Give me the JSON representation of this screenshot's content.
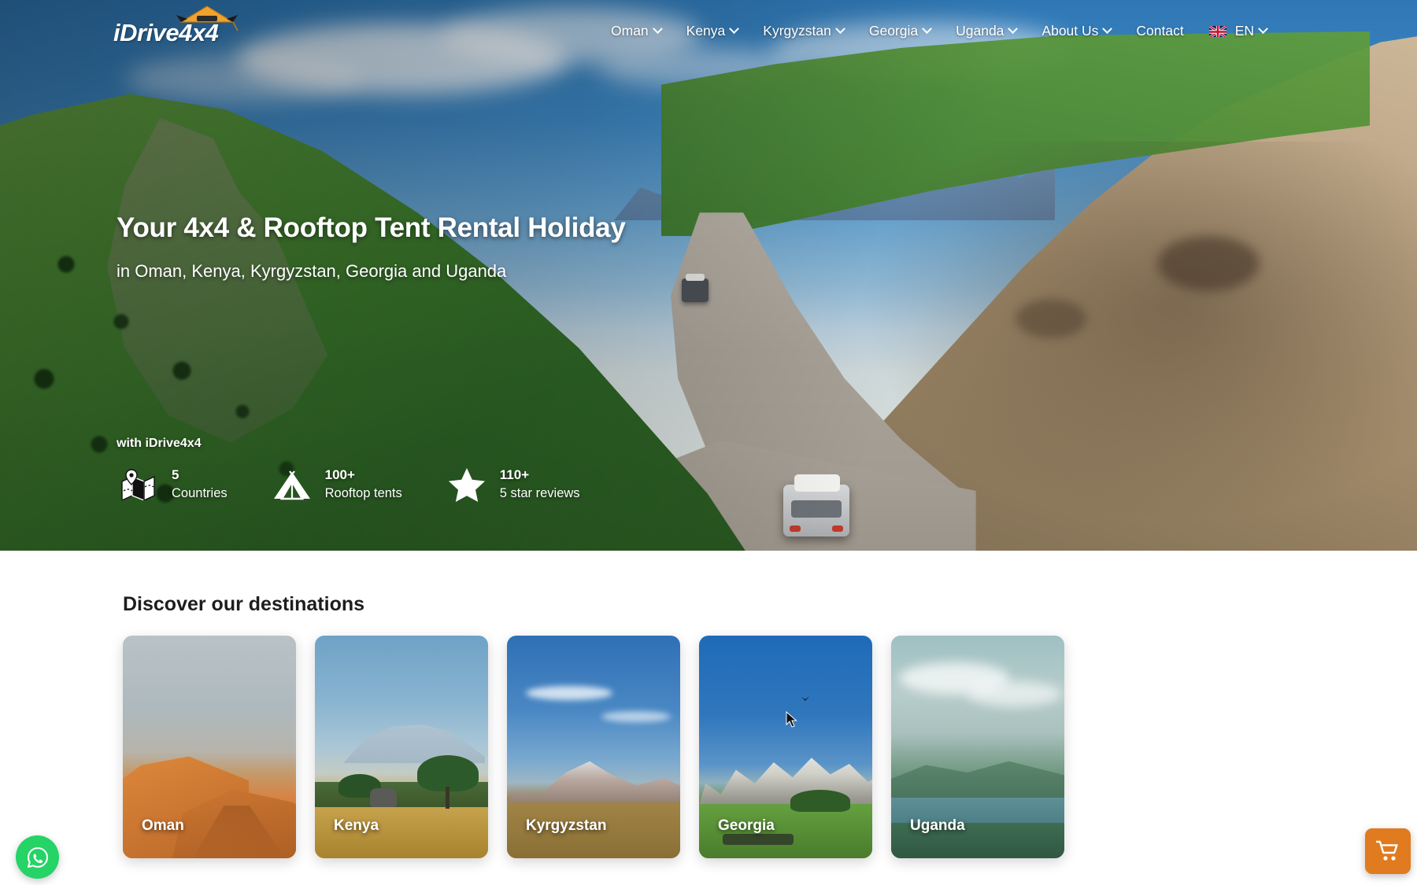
{
  "brand": {
    "logo_text": "iDrive4x4",
    "logo_icon": "rooftop-tent-icon",
    "accent_color": "#e8941f"
  },
  "nav": {
    "items": [
      {
        "label": "Oman",
        "has_dropdown": true
      },
      {
        "label": "Kenya",
        "has_dropdown": true
      },
      {
        "label": "Kyrgyzstan",
        "has_dropdown": true
      },
      {
        "label": "Georgia",
        "has_dropdown": true
      },
      {
        "label": "Uganda",
        "has_dropdown": true
      },
      {
        "label": "About Us",
        "has_dropdown": true
      },
      {
        "label": "Contact",
        "has_dropdown": false
      }
    ],
    "language": {
      "code": "EN",
      "flag_icon": "uk-flag-icon",
      "has_dropdown": true
    }
  },
  "hero": {
    "title": "Your 4x4 & Rooftop Tent Rental Holiday",
    "subtitle": "in Oman, Kenya, Kyrgyzstan, Georgia and Uganda",
    "stats_heading": "with iDrive4x4",
    "stats": [
      {
        "icon": "map-pin-icon",
        "value": "5",
        "label": "Countries"
      },
      {
        "icon": "tent-icon",
        "value": "100+",
        "label": "Rooftop tents"
      },
      {
        "icon": "star-icon",
        "value": "110+",
        "label": "5 star reviews"
      }
    ]
  },
  "destinations": {
    "title": "Discover our destinations",
    "cards": [
      {
        "label": "Oman",
        "theme": "oman"
      },
      {
        "label": "Kenya",
        "theme": "kenya"
      },
      {
        "label": "Kyrgyzstan",
        "theme": "kyr"
      },
      {
        "label": "Georgia",
        "theme": "geo"
      },
      {
        "label": "Uganda",
        "theme": "uga"
      }
    ]
  },
  "floating": {
    "whatsapp": {
      "icon": "whatsapp-icon",
      "color": "#25d366"
    },
    "cart": {
      "icon": "shopping-cart-icon",
      "color": "#e07b1f"
    }
  }
}
